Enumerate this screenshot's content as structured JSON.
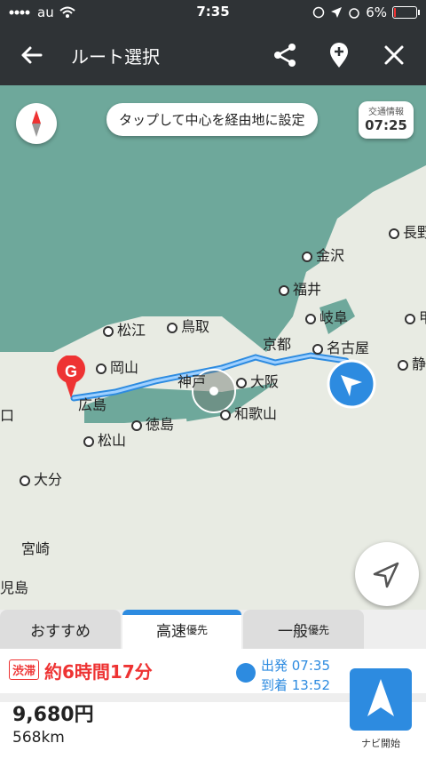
{
  "status": {
    "carrier": "au",
    "time": "7:35",
    "battery": "6%",
    "battery_level": 0.06
  },
  "appbar": {
    "title": "ルート選択"
  },
  "map": {
    "tip": "タップして中心を経由地に設定",
    "traffic_label": "交通情報",
    "traffic_time": "07:25",
    "goal_marker": "G",
    "cities": [
      "長野",
      "金沢",
      "福井",
      "岐阜",
      "甲",
      "松江",
      "鳥取",
      "京都",
      "名古屋",
      "静",
      "岡山",
      "神戸",
      "大阪",
      "広島",
      "徳島",
      "和歌山",
      "松山",
      "口",
      "大分",
      "宮崎",
      "児島"
    ]
  },
  "tabs": [
    {
      "label": "おすすめ",
      "suffix": ""
    },
    {
      "label": "高速",
      "suffix": "優先"
    },
    {
      "label": "一般",
      "suffix": "優先"
    }
  ],
  "summary": {
    "jam_badge": "渋滞",
    "duration": "約6時間17分",
    "depart": "出発 07:35",
    "arrive": "到着 13:52",
    "fare": "9,680円",
    "distance": "568km",
    "nav_label": "ナビ開始"
  },
  "colors": {
    "accent": "#2d8be0",
    "alert": "#e33",
    "sea": "#6ea89b",
    "land": "#e8ebe3"
  }
}
